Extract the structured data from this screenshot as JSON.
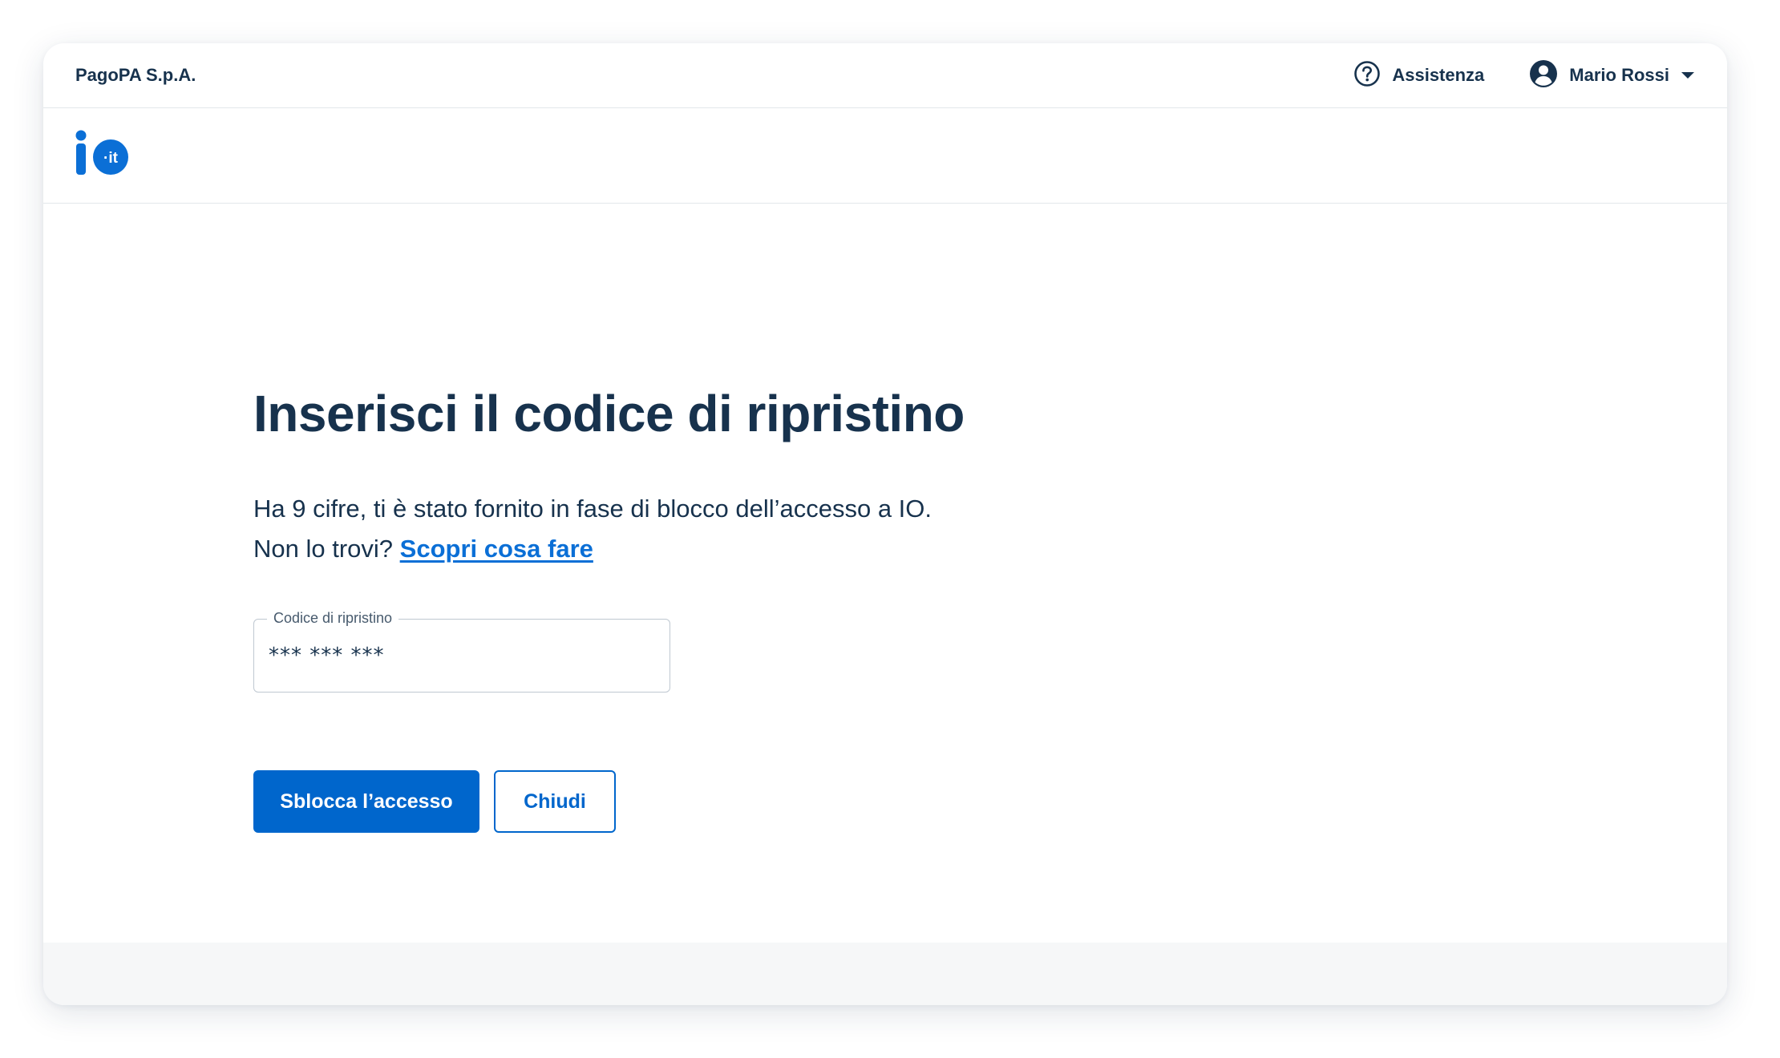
{
  "topbar": {
    "org_name": "PagoPA S.p.A.",
    "help_label": "Assistenza",
    "user_name": "Mario Rossi"
  },
  "brand": {
    "logo_icon": "io-it-logo-icon",
    "logo_text": "·it"
  },
  "main": {
    "title": "Inserisci il codice di ripristino",
    "description_line1": "Ha 9 cifre, ti è stato fornito in fase di blocco dell’accesso a IO.",
    "description_prefix": "Non lo trovi?",
    "help_link": "Scopri cosa fare",
    "field": {
      "label": "Codice di ripristino",
      "value": "*** *** ***"
    },
    "primary_button": "Sblocca l’accesso",
    "secondary_button": "Chiudi"
  },
  "colors": {
    "primary": "#0066cc",
    "text": "#17324d",
    "link": "#0b6fd6"
  }
}
